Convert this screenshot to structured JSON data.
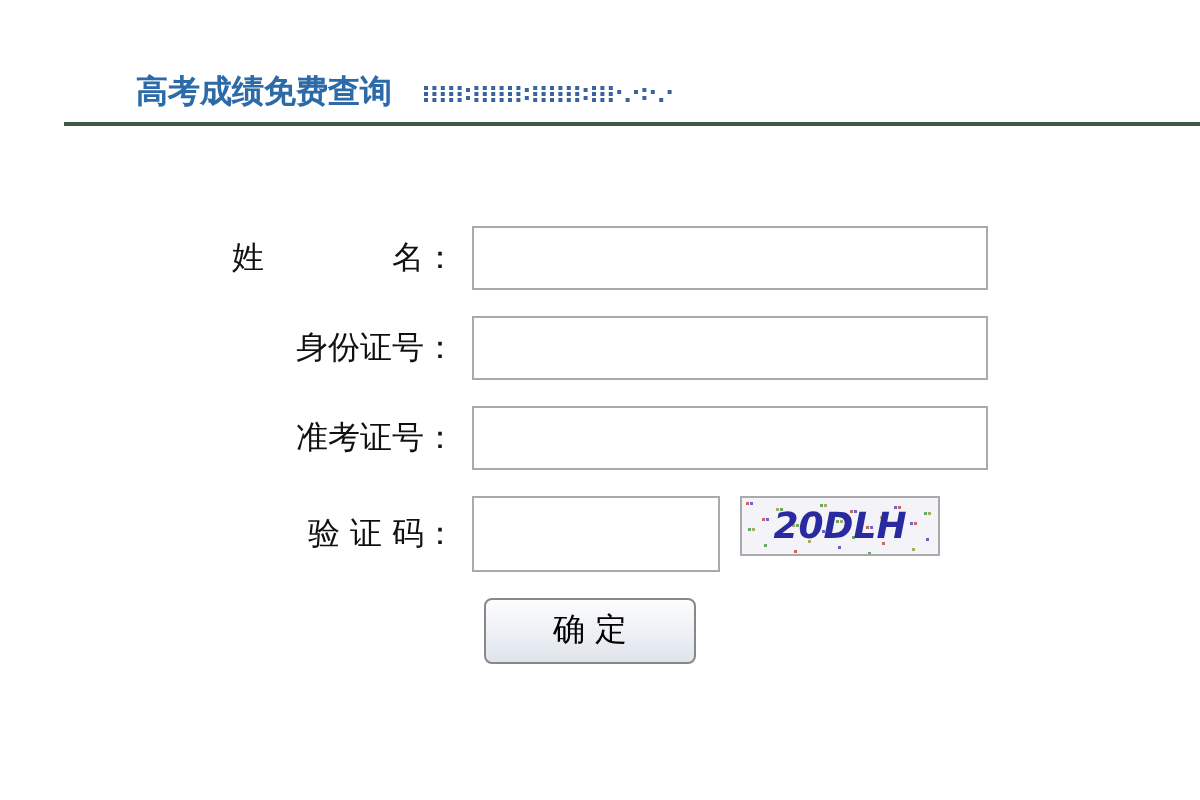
{
  "header": {
    "title": "高考成绩免费查询"
  },
  "fields": [
    {
      "label": "姓　　　　名：",
      "kind": "text"
    },
    {
      "label": "身份证号：",
      "kind": "text"
    },
    {
      "label": "准考证号：",
      "kind": "text"
    },
    {
      "label": "验 证 码：",
      "kind": "captcha",
      "captcha": "20DLH"
    }
  ],
  "submit": {
    "label": "确 定"
  }
}
